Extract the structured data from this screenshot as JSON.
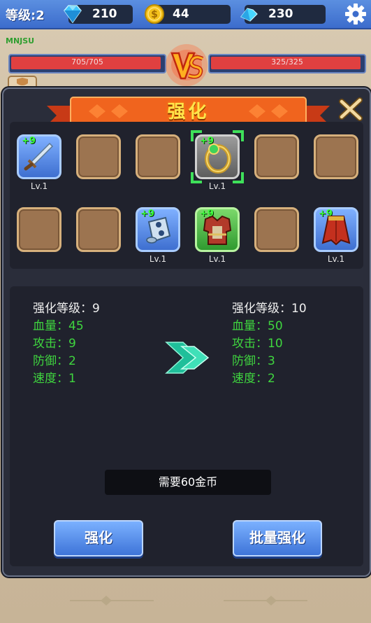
{
  "top_bar": {
    "level_label": "等级:2",
    "gems": "210",
    "gold": "44",
    "crystals": "230"
  },
  "battle": {
    "player_name": "MNJSU",
    "left_hp": "705/705",
    "right_hp": "325/325",
    "left_hp_fraction": 1.0,
    "right_hp_fraction": 1.0
  },
  "panel": {
    "title": "强化",
    "slots": [
      {
        "state": "item",
        "plus": "+9",
        "level": "Lv.1",
        "icon": "sword-icon",
        "selected": false
      },
      {
        "state": "empty"
      },
      {
        "state": "empty"
      },
      {
        "state": "item-gray",
        "plus": "+9",
        "level": "Lv.1",
        "icon": "ring-icon",
        "selected": true
      },
      {
        "state": "empty"
      },
      {
        "state": "empty"
      },
      {
        "state": "empty"
      },
      {
        "state": "empty"
      },
      {
        "state": "item",
        "plus": "+9",
        "level": "Lv.1",
        "icon": "bracer-icon",
        "selected": false
      },
      {
        "state": "item-green",
        "plus": "+9",
        "level": "Lv.1",
        "icon": "armor-icon",
        "selected": false
      },
      {
        "state": "empty"
      },
      {
        "state": "item",
        "plus": "+9",
        "level": "Lv.1",
        "icon": "cape-icon",
        "selected": false
      }
    ],
    "current": {
      "level_line": "强化等级：9",
      "hp_line": "血量：45",
      "attack_line": "攻击：9",
      "defense_line": "防御：2",
      "speed_line": "速度：1"
    },
    "next": {
      "level_line": "强化等级：10",
      "hp_line": "血量：50",
      "attack_line": "攻击：10",
      "defense_line": "防御：3",
      "speed_line": "速度：2"
    },
    "cost": "需要60金币",
    "enhance_button": "强化",
    "batch_button": "批量强化"
  },
  "colors": {
    "accent_green": "#3fd63f",
    "button_blue": "#3e74d8",
    "title_yellow": "#ffe44a"
  }
}
